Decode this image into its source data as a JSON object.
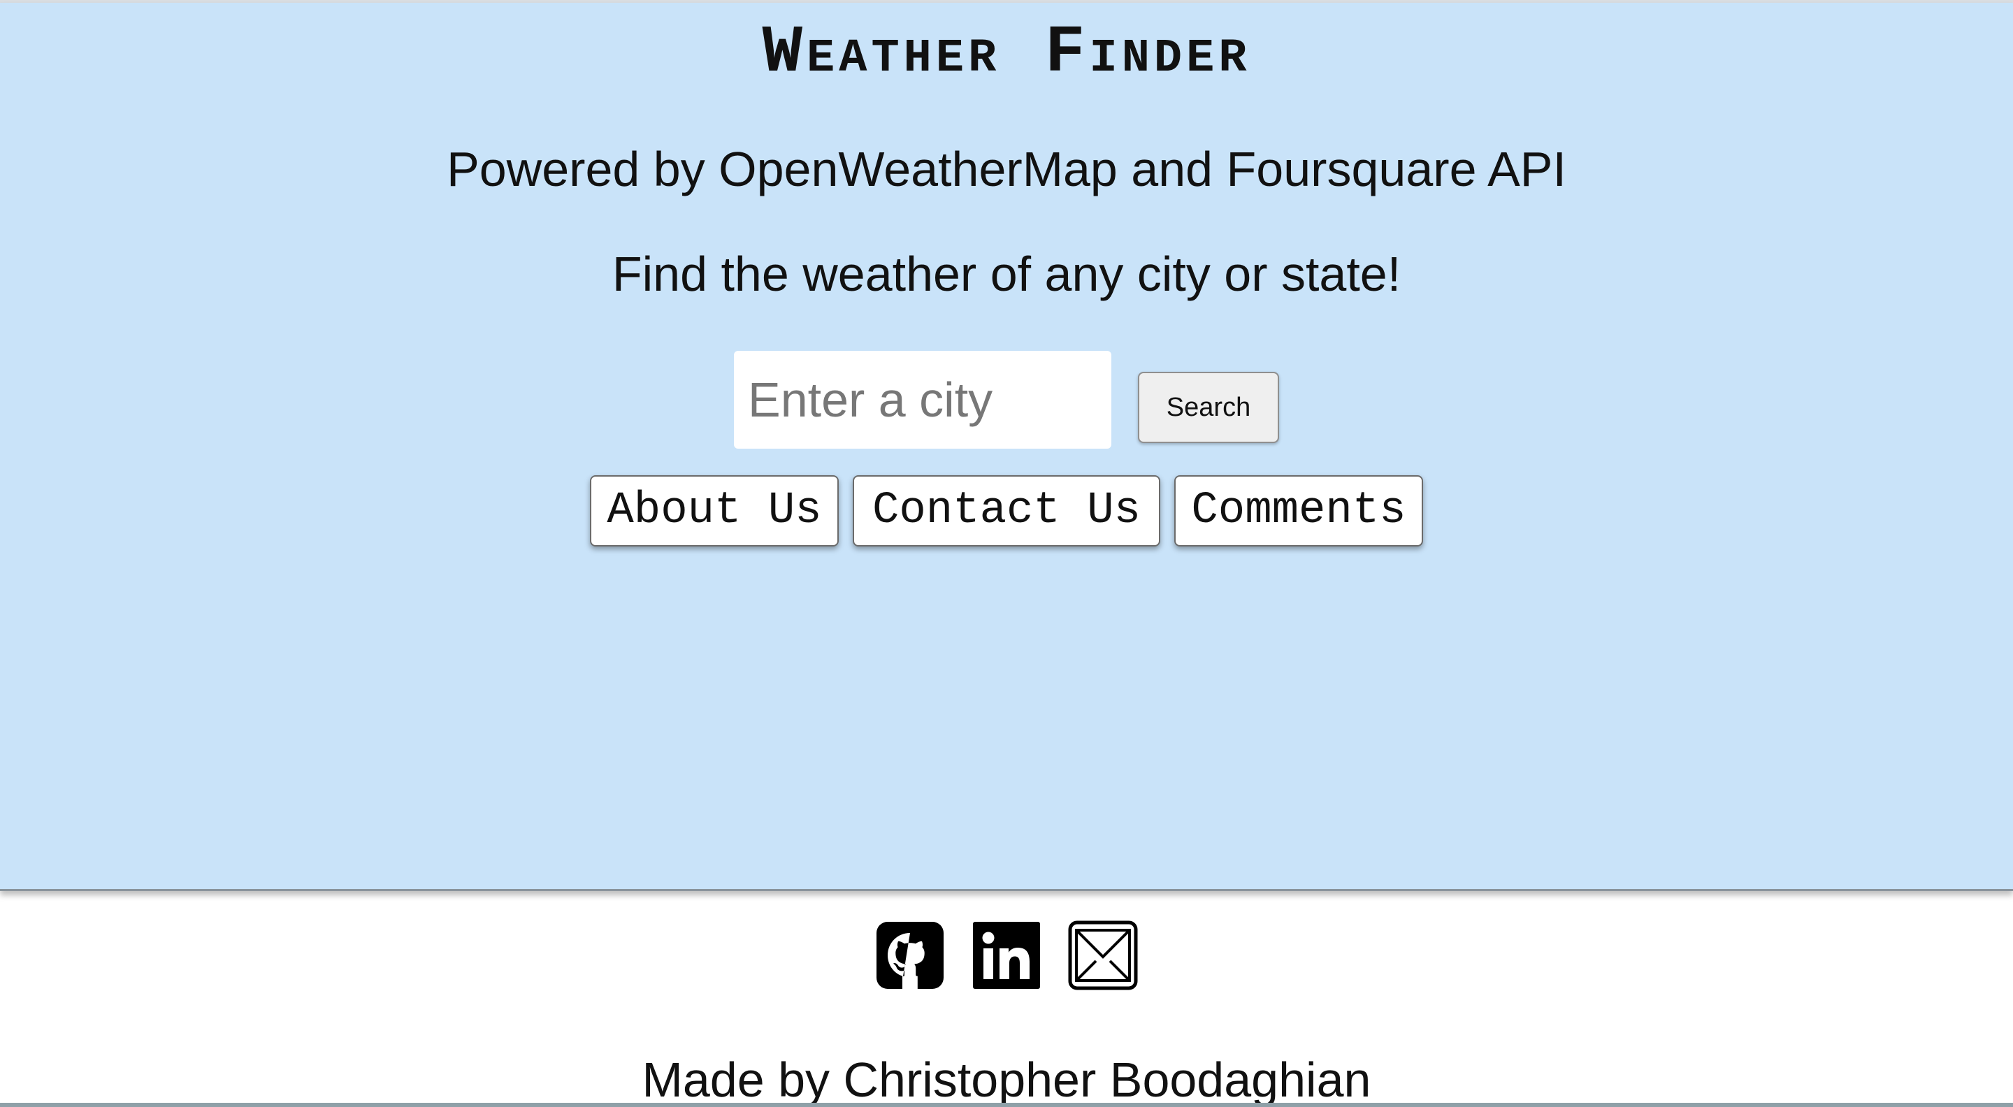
{
  "header": {
    "title": "Weather Finder",
    "subtitle": "Powered by OpenWeatherMap and Foursquare API",
    "tagline": "Find the weather of any city or state!"
  },
  "search": {
    "placeholder": "Enter a city",
    "value": "",
    "button_label": "Search"
  },
  "nav": {
    "items": [
      {
        "label": "About Us"
      },
      {
        "label": "Contact Us"
      },
      {
        "label": "Comments"
      }
    ]
  },
  "footer": {
    "icons": [
      "github-icon",
      "linkedin-icon",
      "email-icon"
    ],
    "credit": "Made by Christopher Boodaghian"
  },
  "colors": {
    "hero_background": "#c9e3f9",
    "footer_background": "#ffffff",
    "text": "#111111"
  }
}
